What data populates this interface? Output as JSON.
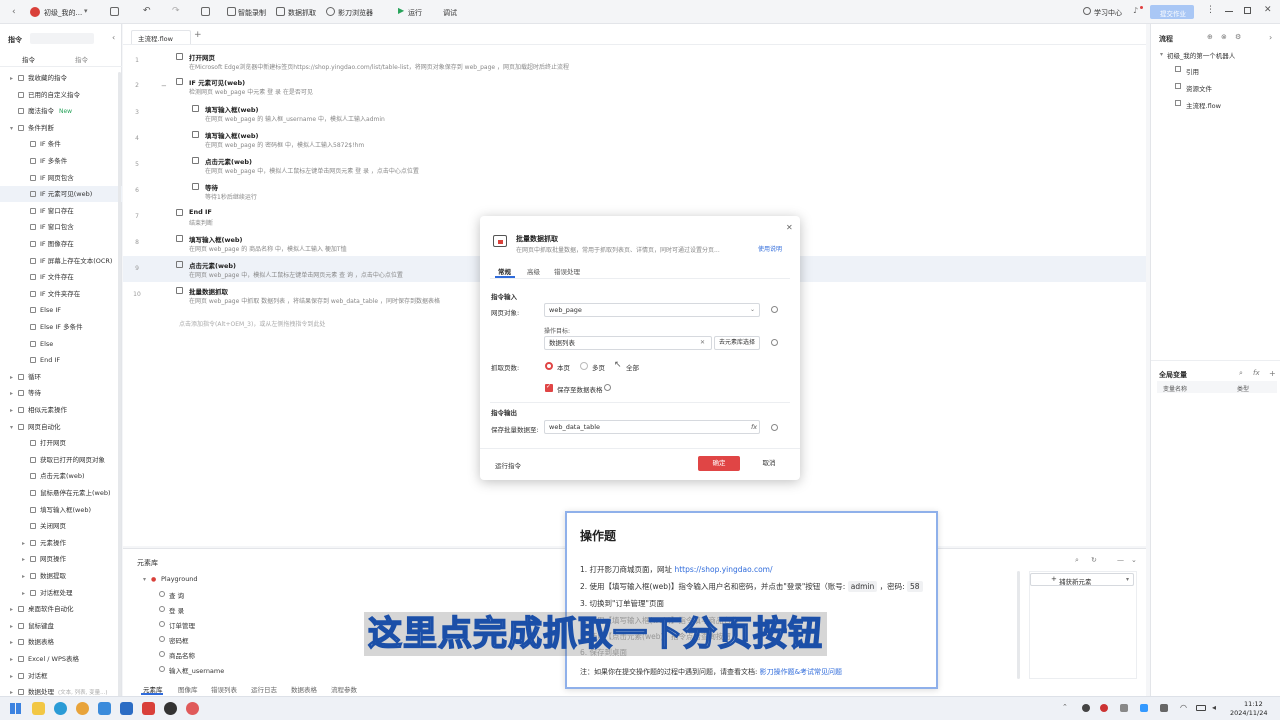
{
  "titlebar": {
    "title": "初级_我的...",
    "smart_record": "智能录制",
    "data_scrape": "数据抓取",
    "browser": "影刀浏览器",
    "run": "运行",
    "debug": "调试",
    "learning_center": "学习中心",
    "publish": "提交作业"
  },
  "sidebar": {
    "header": "指令",
    "tab_basic": "指令",
    "tab_other": "指令",
    "items": [
      {
        "label": "我收藏的指令",
        "indent": 0,
        "caret": "▸"
      },
      {
        "label": "已用的自定义指令",
        "indent": 0,
        "caret": ""
      },
      {
        "label": "魔法指令",
        "indent": 0,
        "caret": "",
        "badge": "New"
      },
      {
        "label": "条件判断",
        "indent": 0,
        "caret": "▾"
      },
      {
        "label": "IF 条件",
        "indent": 1,
        "caret": ""
      },
      {
        "label": "IF 多条件",
        "indent": 1,
        "caret": ""
      },
      {
        "label": "IF 网页包含",
        "indent": 1,
        "caret": ""
      },
      {
        "label": "IF 元素可见(web)",
        "indent": 1,
        "caret": "",
        "selected": true
      },
      {
        "label": "IF 窗口存在",
        "indent": 1,
        "caret": ""
      },
      {
        "label": "IF 窗口包含",
        "indent": 1,
        "caret": ""
      },
      {
        "label": "IF 图像存在",
        "indent": 1,
        "caret": ""
      },
      {
        "label": "IF 屏幕上存在文本(OCR)",
        "indent": 1,
        "caret": ""
      },
      {
        "label": "IF 文件存在",
        "indent": 1,
        "caret": ""
      },
      {
        "label": "IF 文件夹存在",
        "indent": 1,
        "caret": ""
      },
      {
        "label": "Else IF",
        "indent": 1,
        "caret": ""
      },
      {
        "label": "Else IF 多条件",
        "indent": 1,
        "caret": ""
      },
      {
        "label": "Else",
        "indent": 1,
        "caret": ""
      },
      {
        "label": "End IF",
        "indent": 1,
        "caret": ""
      },
      {
        "label": "循环",
        "indent": 0,
        "caret": "▸"
      },
      {
        "label": "等待",
        "indent": 0,
        "caret": "▸"
      },
      {
        "label": "相似元素操作",
        "indent": 0,
        "caret": "▸"
      },
      {
        "label": "网页自动化",
        "indent": 0,
        "caret": "▾"
      },
      {
        "label": "打开网页",
        "indent": 1,
        "caret": ""
      },
      {
        "label": "获取已打开的网页对象",
        "indent": 1,
        "caret": ""
      },
      {
        "label": "点击元素(web)",
        "indent": 1,
        "caret": ""
      },
      {
        "label": "鼠标悬停在元素上(web)",
        "indent": 1,
        "caret": ""
      },
      {
        "label": "填写输入框(web)",
        "indent": 1,
        "caret": ""
      },
      {
        "label": "关闭网页",
        "indent": 1,
        "caret": ""
      },
      {
        "label": "元素操作",
        "indent": 1,
        "caret": "▸"
      },
      {
        "label": "网页操作",
        "indent": 1,
        "caret": "▸"
      },
      {
        "label": "数据提取",
        "indent": 1,
        "caret": "▸"
      },
      {
        "label": "对话框处理",
        "indent": 1,
        "caret": "▸"
      },
      {
        "label": "桌面软件自动化",
        "indent": 0,
        "caret": "▸"
      },
      {
        "label": "鼠标键盘",
        "indent": 0,
        "caret": "▸"
      },
      {
        "label": "数据表格",
        "indent": 0,
        "caret": "▸"
      },
      {
        "label": "Excel / WPS表格",
        "indent": 0,
        "caret": "▸"
      },
      {
        "label": "对话框",
        "indent": 0,
        "caret": "▸"
      },
      {
        "label": "数据处理",
        "indent": 0,
        "caret": "▸",
        "suffix": "(文本, 列表, 变量...)"
      }
    ]
  },
  "editor": {
    "tab": "主流程.flow",
    "steps": [
      {
        "n": "1",
        "title": "打开网页",
        "desc": "在Microsoft Edge浏览器中新建标签页https://shop.yingdao.com/list/table-list，将网页对象保存到 web_page ，网页加载超时后终止流程"
      },
      {
        "n": "2",
        "title": "IF 元素可见(web)",
        "desc": "检测网页 web_page 中元素 登 录 在是否可见"
      },
      {
        "n": "3",
        "title": "填写输入框(web)",
        "desc": "在网页 web_page 的 输入框_username 中，模拟人工输入admin"
      },
      {
        "n": "4",
        "title": "填写输入框(web)",
        "desc": "在网页 web_page 的 密码框 中，模拟人工输入5872$!hm"
      },
      {
        "n": "5",
        "title": "点击元素(web)",
        "desc": "在网页 web_page 中，模拟人工鼠标左键单击网页元素 登 录 ，点击中心点位置"
      },
      {
        "n": "6",
        "title": "等待",
        "desc": "等待1秒后继续运行"
      },
      {
        "n": "7",
        "title": "End IF",
        "desc": "结束判断"
      },
      {
        "n": "8",
        "title": "填写输入框(web)",
        "desc": "在网页 web_page 的 商品名称 中，模拟人工输入 梗加T恤"
      },
      {
        "n": "9",
        "title": "点击元素(web)",
        "desc": "在网页 web_page 中，模拟人工鼠标左键单击网页元素 查 询 ，点击中心点位置"
      },
      {
        "n": "10",
        "title": "批量数据抓取",
        "desc": "在网页 web_page 中抓取 数据列表 ，将结果保存到 web_data_table ，同时保存到数据表格"
      }
    ],
    "add_hint": "点击添加指令(Alt+OEM_3)，或从左侧拖拽指令到此处"
  },
  "right_panel": {
    "flow_title": "流程",
    "project": "初级_我的第一个机器人",
    "items": [
      "引用",
      "资源文件",
      "主流程.flow"
    ],
    "vars_title": "全局变量",
    "col_name": "变量名称",
    "col_type": "类型"
  },
  "element_library": {
    "title": "元素库",
    "root": "Playground",
    "elements": [
      "查 询",
      "登 录",
      "订单管理",
      "密码框",
      "商品名称",
      "输入框_username"
    ],
    "add_button": "捕获新元素",
    "tabs": [
      "元素库",
      "图像库",
      "错误列表",
      "运行日志",
      "数据表格",
      "流程参数"
    ]
  },
  "dialog": {
    "title": "批量数据抓取",
    "subtitle": "在网页中抓取批量数据，常用于抓取列表页、详情页，同时可通过设置分页...",
    "help": "使用说明",
    "tabs": [
      "常规",
      "高级",
      "错误处理"
    ],
    "section_input": "指令输入",
    "web_object_label": "网页对象:",
    "web_object_value": "web_page",
    "target_label": "操作目标:",
    "target_value": "数据列表",
    "target_button": "去元素库选择",
    "pages_label": "抓取页数:",
    "pages_options": [
      "本页",
      "多页",
      "全部"
    ],
    "save_table_label": "保存至数据表格",
    "section_output": "指令输出",
    "save_label": "保存批量数据至:",
    "save_value": "web_data_table",
    "run_command": "运行指令",
    "confirm": "确定",
    "cancel": "取消"
  },
  "question": {
    "title": "操作题",
    "line1_prefix": "1. 打开影刀商城页面，网址",
    "line1_url": "https://shop.yingdao.com/",
    "line2": "2. 使用【填写输入框(web)】指令输入用户名和密码，并点击\"登录\"按钮（账号:",
    "line2_user": "admin",
    "line2_pw": "，密码:",
    "line2_pw_val": "58",
    "line3": "3. 切换到\"订单管理\"页面",
    "line4": "4. 使用【填写输入框(web)】指令填写商品名称",
    "line5": "5. 使用【点击元素(web)】指令点击查询按钮",
    "line6": "6. 保存到桌面",
    "note_prefix": "注：如果你在提交操作题的过程中遇到问题，请查看文档:",
    "note_link": "影刀操作题&考试常见问题"
  },
  "subtitle_text": "这里点完成抓取一下分页按钮",
  "taskbar": {
    "time": "11:12",
    "date": "2024/11/24"
  }
}
